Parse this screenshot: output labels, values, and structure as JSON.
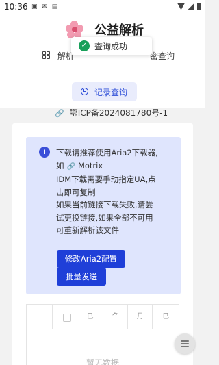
{
  "status_bar": {
    "time": "10:36",
    "left_icons": [
      "sim-icon",
      "notification-icon",
      "app-icon"
    ],
    "right_icons": [
      "wifi-icon",
      "signal-icon",
      "battery-icon"
    ]
  },
  "header": {
    "app_title": "公益解析",
    "nav_left": "解析",
    "nav_right": "密查询",
    "history_button": "记录查询",
    "icp": "鄂ICP备2024081780号-1"
  },
  "toast": {
    "message": "查询成功"
  },
  "info": {
    "line1": "下载请推荐使用Aria2下载器,",
    "line2_prefix": "如",
    "line2_link": "Motrix",
    "line3": "IDM下载需要手动指定UA,点",
    "line4": "击即可复制",
    "line5": "如果当前链接下载失败,请尝",
    "line6": "试更换链接,如果全部不可用",
    "line7": "可重新解析该文件",
    "btn_aria": "修改Aria2配置",
    "btn_batch": "批量发送"
  },
  "table": {
    "headers": [
      "",
      "",
      "⺋",
      "⺈",
      "⺆",
      "⺋"
    ],
    "empty_text": "暂无数据"
  },
  "colors": {
    "primary": "#1f3fd8",
    "info_bg": "#dfe5fd",
    "success": "#19a05a",
    "logo_pink": "#f29bb1"
  }
}
